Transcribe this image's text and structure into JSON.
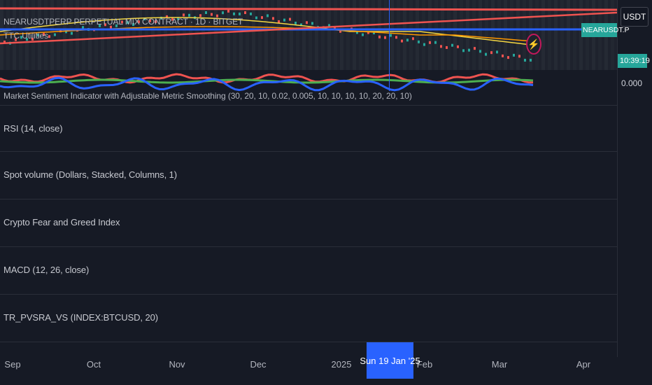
{
  "main": {
    "title": "NEARUSDTPERP PERPETUAL MIX CONTRACT · 1D · BITGET",
    "utilities": "TTC Utilities",
    "symbol_tag": "NEARUSDT.P",
    "time_tag": "10:39:19",
    "currency": "USDT"
  },
  "sentiment": {
    "title": "Market Sentiment Indicator with Adjustable Metric Smoothing (30, 20, 10, 0.02, 0.005, 10, 10, 10, 10, 20, 20, 10)",
    "zero_label": "0.000"
  },
  "panes": [
    {
      "title": "RSI (14, close)"
    },
    {
      "title": "Spot volume (Dollars, Stacked, Columns, 1)"
    },
    {
      "title": "Crypto Fear and Greed Index"
    },
    {
      "title": "MACD (12, 26, close)"
    },
    {
      "title": "TR_PVSRA_VS (INDEX:BTCUSD, 20)"
    }
  ],
  "time_axis": {
    "labels": [
      "Sep",
      "Oct",
      "Nov",
      "Dec",
      "2025",
      "Feb",
      "Mar",
      "Apr"
    ],
    "crosshair": "Sun 19 Jan '25"
  },
  "colors": {
    "background": "#161a25",
    "pane": "#1e222d",
    "accent_blue": "#2962ff",
    "tag_green": "#26a69a",
    "line_red": "#ef5350",
    "line_green": "#4caf50",
    "line_blue": "#2962ff",
    "line_yellow": "#f5d742"
  },
  "icons": [
    "bolt-icon"
  ]
}
